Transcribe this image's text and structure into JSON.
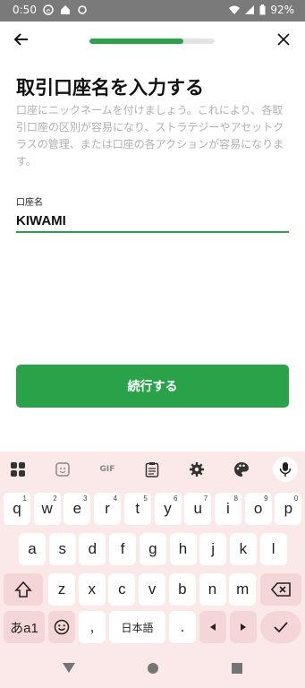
{
  "status": {
    "time": "0:50",
    "battery": "92%"
  },
  "progress": {
    "fraction": 0.75
  },
  "content": {
    "title": "取引口座名を入力する",
    "description": "口座にニックネームを付けましょう。これにより、各取引口座の区別が容易になり、ストラテジーやアセットクラスの管理、または口座の各アクションが容易になります。",
    "field_label": "口座名",
    "field_value": "KIWAMI",
    "continue_label": "続行する"
  },
  "keyboard": {
    "gif_label": "GIF",
    "row1": [
      "q",
      "w",
      "e",
      "r",
      "t",
      "y",
      "u",
      "i",
      "o",
      "p"
    ],
    "row1_sup": [
      "1",
      "2",
      "3",
      "4",
      "5",
      "6",
      "7",
      "8",
      "9",
      "0"
    ],
    "row2": [
      "a",
      "s",
      "d",
      "f",
      "g",
      "h",
      "j",
      "k",
      "l"
    ],
    "row3": [
      "z",
      "x",
      "c",
      "v",
      "b",
      "n",
      "m"
    ],
    "lang_key": "あa1",
    "comma": ",",
    "space_label": "日本語",
    "period": "."
  },
  "icons": {
    "back": "arrow-left-icon",
    "close": "close-icon",
    "apps": "apps-icon",
    "sticker": "sticker-icon",
    "clipboard": "clipboard-icon",
    "settings": "gear-icon",
    "theme": "palette-icon",
    "mic": "mic-icon"
  },
  "colors": {
    "accent": "#2aa24a",
    "keyboard_bg": "#fbe9ea"
  }
}
